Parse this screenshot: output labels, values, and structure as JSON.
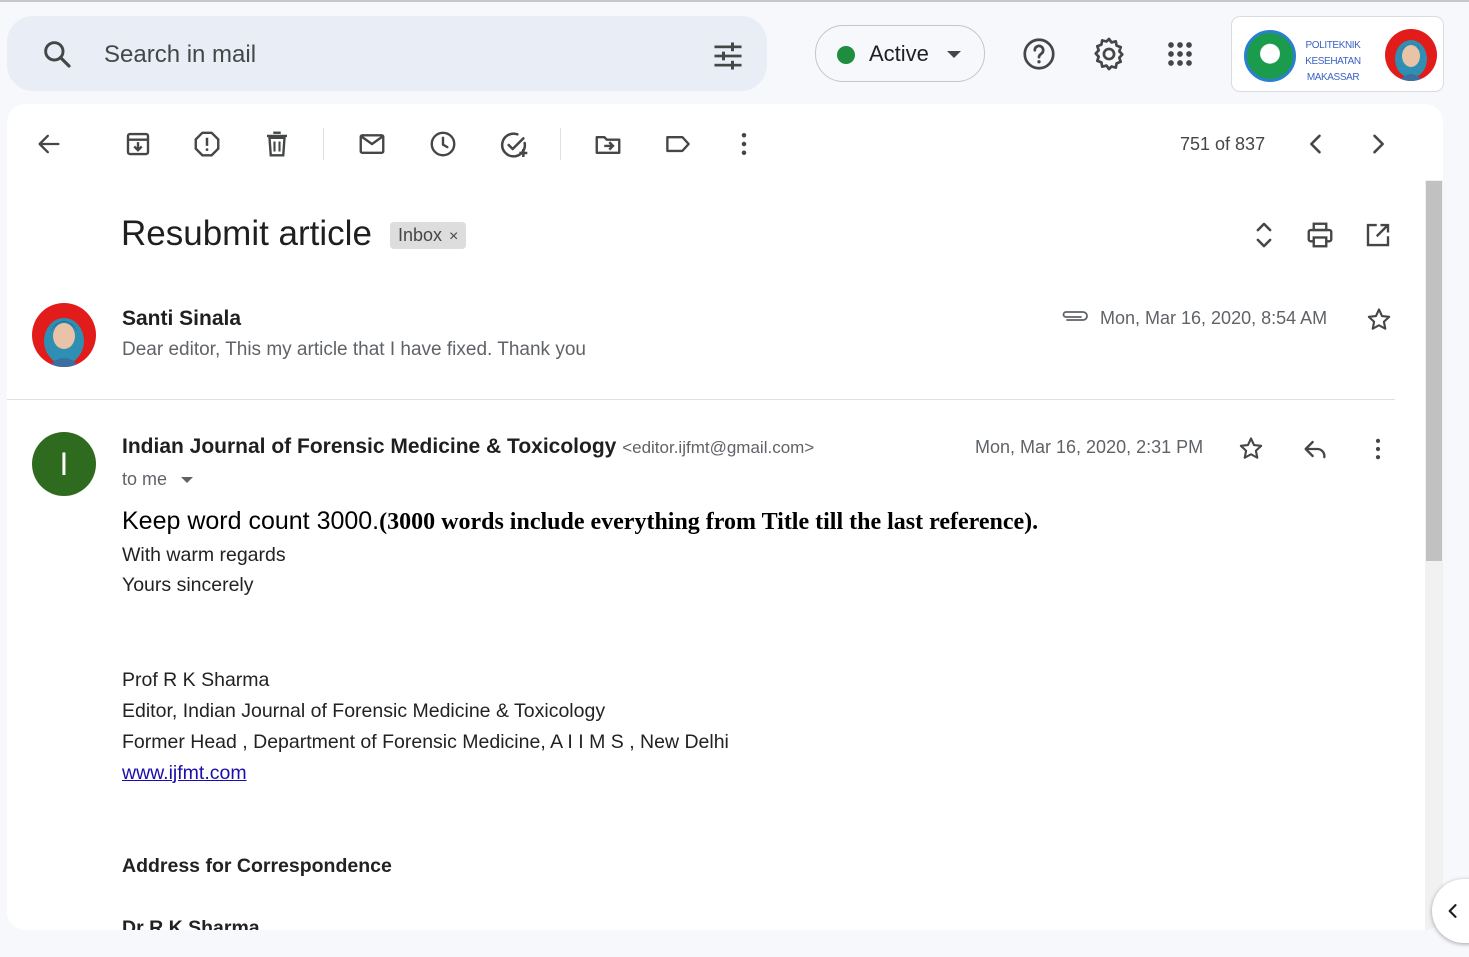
{
  "search": {
    "placeholder": "Search in mail"
  },
  "status": {
    "label": "Active",
    "color": "#1e8e3e"
  },
  "account": {
    "logo_text": "POLITEKNIK KESEHATAN MAKASSAR"
  },
  "toolbar": {
    "icons": [
      "back-arrow-icon",
      "archive-icon",
      "report-spam-icon",
      "delete-icon",
      "mark-unread-icon",
      "snooze-icon",
      "add-task-icon",
      "move-to-icon",
      "label-icon",
      "more-vert-icon"
    ],
    "counter": "751 of 837"
  },
  "thread": {
    "subject": "Resubmit article",
    "label_chip": "Inbox",
    "chip_close": "×"
  },
  "message1": {
    "sender": "Santi Sinala",
    "snippet": "Dear editor, This my article that I have fixed. Thank you",
    "date": "Mon, Mar 16, 2020, 8:54 AM"
  },
  "message2": {
    "avatar_letter": "I",
    "sender": "Indian Journal of Forensic Medicine & Toxicology",
    "email": "<editor.ijfmt@gmail.com>",
    "date": "Mon, Mar 16, 2020, 2:31 PM",
    "to": "to me",
    "body": {
      "keep_a": "Keep word count 3000.",
      "keep_b": "(3000 words include everything from Title till the last reference).",
      "regards": "With warm regards",
      "sincerely": "Yours sincerely",
      "sig_name": "Prof R K Sharma",
      "sig_role": "Editor, Indian Journal of Forensic Medicine & Toxicology",
      "sig_former": "Former Head , Department of Forensic Medicine, A I I M S , New Delhi",
      "sig_link": "www.ijfmt.com",
      "address_heading": "Address for Correspondence",
      "address_name": "Dr R K Sharma"
    }
  }
}
